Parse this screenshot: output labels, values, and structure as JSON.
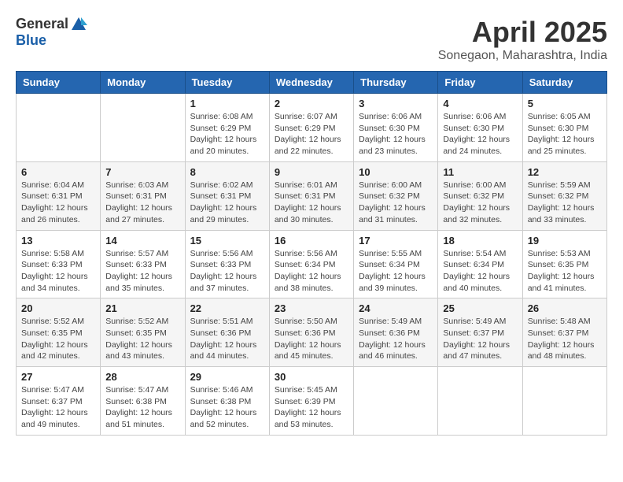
{
  "logo": {
    "text1": "General",
    "text2": "Blue"
  },
  "title": "April 2025",
  "location": "Sonegaon, Maharashtra, India",
  "headers": [
    "Sunday",
    "Monday",
    "Tuesday",
    "Wednesday",
    "Thursday",
    "Friday",
    "Saturday"
  ],
  "weeks": [
    [
      {
        "day": "",
        "info": ""
      },
      {
        "day": "",
        "info": ""
      },
      {
        "day": "1",
        "info": "Sunrise: 6:08 AM\nSunset: 6:29 PM\nDaylight: 12 hours and 20 minutes."
      },
      {
        "day": "2",
        "info": "Sunrise: 6:07 AM\nSunset: 6:29 PM\nDaylight: 12 hours and 22 minutes."
      },
      {
        "day": "3",
        "info": "Sunrise: 6:06 AM\nSunset: 6:30 PM\nDaylight: 12 hours and 23 minutes."
      },
      {
        "day": "4",
        "info": "Sunrise: 6:06 AM\nSunset: 6:30 PM\nDaylight: 12 hours and 24 minutes."
      },
      {
        "day": "5",
        "info": "Sunrise: 6:05 AM\nSunset: 6:30 PM\nDaylight: 12 hours and 25 minutes."
      }
    ],
    [
      {
        "day": "6",
        "info": "Sunrise: 6:04 AM\nSunset: 6:31 PM\nDaylight: 12 hours and 26 minutes."
      },
      {
        "day": "7",
        "info": "Sunrise: 6:03 AM\nSunset: 6:31 PM\nDaylight: 12 hours and 27 minutes."
      },
      {
        "day": "8",
        "info": "Sunrise: 6:02 AM\nSunset: 6:31 PM\nDaylight: 12 hours and 29 minutes."
      },
      {
        "day": "9",
        "info": "Sunrise: 6:01 AM\nSunset: 6:31 PM\nDaylight: 12 hours and 30 minutes."
      },
      {
        "day": "10",
        "info": "Sunrise: 6:00 AM\nSunset: 6:32 PM\nDaylight: 12 hours and 31 minutes."
      },
      {
        "day": "11",
        "info": "Sunrise: 6:00 AM\nSunset: 6:32 PM\nDaylight: 12 hours and 32 minutes."
      },
      {
        "day": "12",
        "info": "Sunrise: 5:59 AM\nSunset: 6:32 PM\nDaylight: 12 hours and 33 minutes."
      }
    ],
    [
      {
        "day": "13",
        "info": "Sunrise: 5:58 AM\nSunset: 6:33 PM\nDaylight: 12 hours and 34 minutes."
      },
      {
        "day": "14",
        "info": "Sunrise: 5:57 AM\nSunset: 6:33 PM\nDaylight: 12 hours and 35 minutes."
      },
      {
        "day": "15",
        "info": "Sunrise: 5:56 AM\nSunset: 6:33 PM\nDaylight: 12 hours and 37 minutes."
      },
      {
        "day": "16",
        "info": "Sunrise: 5:56 AM\nSunset: 6:34 PM\nDaylight: 12 hours and 38 minutes."
      },
      {
        "day": "17",
        "info": "Sunrise: 5:55 AM\nSunset: 6:34 PM\nDaylight: 12 hours and 39 minutes."
      },
      {
        "day": "18",
        "info": "Sunrise: 5:54 AM\nSunset: 6:34 PM\nDaylight: 12 hours and 40 minutes."
      },
      {
        "day": "19",
        "info": "Sunrise: 5:53 AM\nSunset: 6:35 PM\nDaylight: 12 hours and 41 minutes."
      }
    ],
    [
      {
        "day": "20",
        "info": "Sunrise: 5:52 AM\nSunset: 6:35 PM\nDaylight: 12 hours and 42 minutes."
      },
      {
        "day": "21",
        "info": "Sunrise: 5:52 AM\nSunset: 6:35 PM\nDaylight: 12 hours and 43 minutes."
      },
      {
        "day": "22",
        "info": "Sunrise: 5:51 AM\nSunset: 6:36 PM\nDaylight: 12 hours and 44 minutes."
      },
      {
        "day": "23",
        "info": "Sunrise: 5:50 AM\nSunset: 6:36 PM\nDaylight: 12 hours and 45 minutes."
      },
      {
        "day": "24",
        "info": "Sunrise: 5:49 AM\nSunset: 6:36 PM\nDaylight: 12 hours and 46 minutes."
      },
      {
        "day": "25",
        "info": "Sunrise: 5:49 AM\nSunset: 6:37 PM\nDaylight: 12 hours and 47 minutes."
      },
      {
        "day": "26",
        "info": "Sunrise: 5:48 AM\nSunset: 6:37 PM\nDaylight: 12 hours and 48 minutes."
      }
    ],
    [
      {
        "day": "27",
        "info": "Sunrise: 5:47 AM\nSunset: 6:37 PM\nDaylight: 12 hours and 49 minutes."
      },
      {
        "day": "28",
        "info": "Sunrise: 5:47 AM\nSunset: 6:38 PM\nDaylight: 12 hours and 51 minutes."
      },
      {
        "day": "29",
        "info": "Sunrise: 5:46 AM\nSunset: 6:38 PM\nDaylight: 12 hours and 52 minutes."
      },
      {
        "day": "30",
        "info": "Sunrise: 5:45 AM\nSunset: 6:39 PM\nDaylight: 12 hours and 53 minutes."
      },
      {
        "day": "",
        "info": ""
      },
      {
        "day": "",
        "info": ""
      },
      {
        "day": "",
        "info": ""
      }
    ]
  ]
}
